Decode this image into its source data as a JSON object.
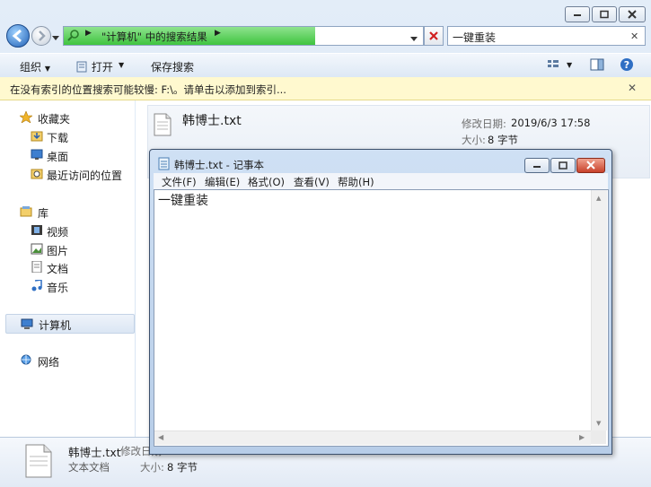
{
  "address": {
    "path_segment": "\"计算机\" 中的搜索结果",
    "progress_pct": 70
  },
  "search": {
    "value": "一键重装"
  },
  "toolbar": {
    "organize": "组织",
    "open": "打开",
    "save_search": "保存搜索"
  },
  "infobar": {
    "text": "在没有索引的位置搜索可能较慢: F:\\。请单击以添加到索引..."
  },
  "nav": {
    "favorites": "收藏夹",
    "downloads": "下载",
    "desktop": "桌面",
    "recent": "最近访问的位置",
    "libraries": "库",
    "videos": "视频",
    "pictures": "图片",
    "documents": "文档",
    "music": "音乐",
    "computer": "计算机",
    "network": "网络"
  },
  "result": {
    "filename": "韩博士.txt",
    "modified_label": "修改日期:",
    "modified_value": "2019/6/3 17:58",
    "size_label": "大小:",
    "size_value": "8 字节"
  },
  "details": {
    "filename": "韩博士.txt",
    "modified_label": "修改日期:",
    "type": "文本文档",
    "size_label": "大小:",
    "size_value": "8 字节"
  },
  "notepad": {
    "title": "韩博士.txt - 记事本",
    "menu": [
      "文件(F)",
      "编辑(E)",
      "格式(O)",
      "查看(V)",
      "帮助(H)"
    ],
    "content": "一键重装"
  }
}
